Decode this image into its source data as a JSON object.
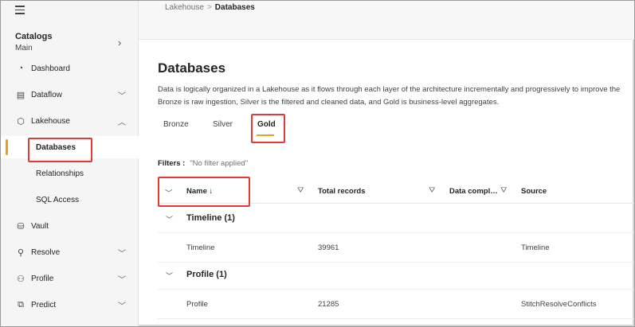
{
  "sidebar": {
    "catalogs_title": "Catalogs",
    "catalogs_sub": "Main",
    "items": [
      {
        "label": "Dashboard"
      },
      {
        "label": "Dataflow"
      },
      {
        "label": "Lakehouse"
      },
      {
        "label": "Databases"
      },
      {
        "label": "Relationships"
      },
      {
        "label": "SQL Access"
      },
      {
        "label": "Vault"
      },
      {
        "label": "Resolve"
      },
      {
        "label": "Profile"
      },
      {
        "label": "Predict"
      }
    ]
  },
  "breadcrumb": {
    "parent": "Lakehouse",
    "separator": ">",
    "current": "Databases"
  },
  "page": {
    "title": "Databases",
    "desc_line1": "Data is logically organized in a Lakehouse as it flows through each layer of the architecture incrementally and progressively to improve the",
    "desc_line2": "Bronze is raw ingestion, Silver is the filtered and cleaned data, and Gold is business-level aggregates."
  },
  "tabs": [
    "Bronze",
    "Silver",
    "Gold"
  ],
  "filters": {
    "label": "Filters :",
    "value": "\"No filter applied\""
  },
  "table": {
    "columns": [
      "Name ↓",
      "Total records",
      "Data compl…",
      "Source"
    ],
    "groups": [
      {
        "label": "Timeline (1)",
        "rows": [
          {
            "name": "Timeline",
            "records": "39961",
            "source": "Timeline"
          }
        ]
      },
      {
        "label": "Profile (1)",
        "rows": [
          {
            "name": "Profile",
            "records": "21285",
            "source": "StitchResolveConflicts"
          }
        ]
      }
    ]
  },
  "colors": {
    "accent": "#e8a317",
    "highlight": "#e53935"
  }
}
